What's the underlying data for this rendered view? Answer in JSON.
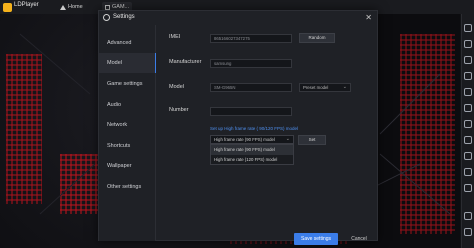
{
  "host": {
    "app_title": "LDPlayer",
    "tabs": [
      {
        "label": "Home"
      },
      {
        "label": "GAM..."
      }
    ]
  },
  "dialog": {
    "title": "Settings",
    "close_glyph": "✕",
    "nav": [
      {
        "label": "Advanced"
      },
      {
        "label": "Model"
      },
      {
        "label": "Game settings"
      },
      {
        "label": "Audio"
      },
      {
        "label": "Network"
      },
      {
        "label": "Shortcuts"
      },
      {
        "label": "Wallpaper"
      },
      {
        "label": "Other settings"
      }
    ],
    "active_nav": "Model",
    "imei": {
      "label": "IMEI",
      "value": "865166027347275",
      "button": "Random"
    },
    "manufacturer": {
      "label": "Manufacturer",
      "value": "samsung"
    },
    "model": {
      "label": "Model",
      "value": "SM-G965N",
      "select_value": "Preset model"
    },
    "number": {
      "label": "Number",
      "value": ""
    },
    "fps_link": "Set up High frame rate ( 90/120 FPS) model",
    "fps_select_value": "High frame rate (90 FPS) model",
    "fps_set_button": "Set",
    "fps_options": [
      "High frame rate (90 FPS) model",
      "High frame rate (120 FPS) model"
    ],
    "save_button": "Save settings",
    "cancel_button": "Cancel"
  },
  "colors": {
    "accent": "#3b7de8",
    "link": "#4f90f0",
    "panel": "#1f2126"
  }
}
